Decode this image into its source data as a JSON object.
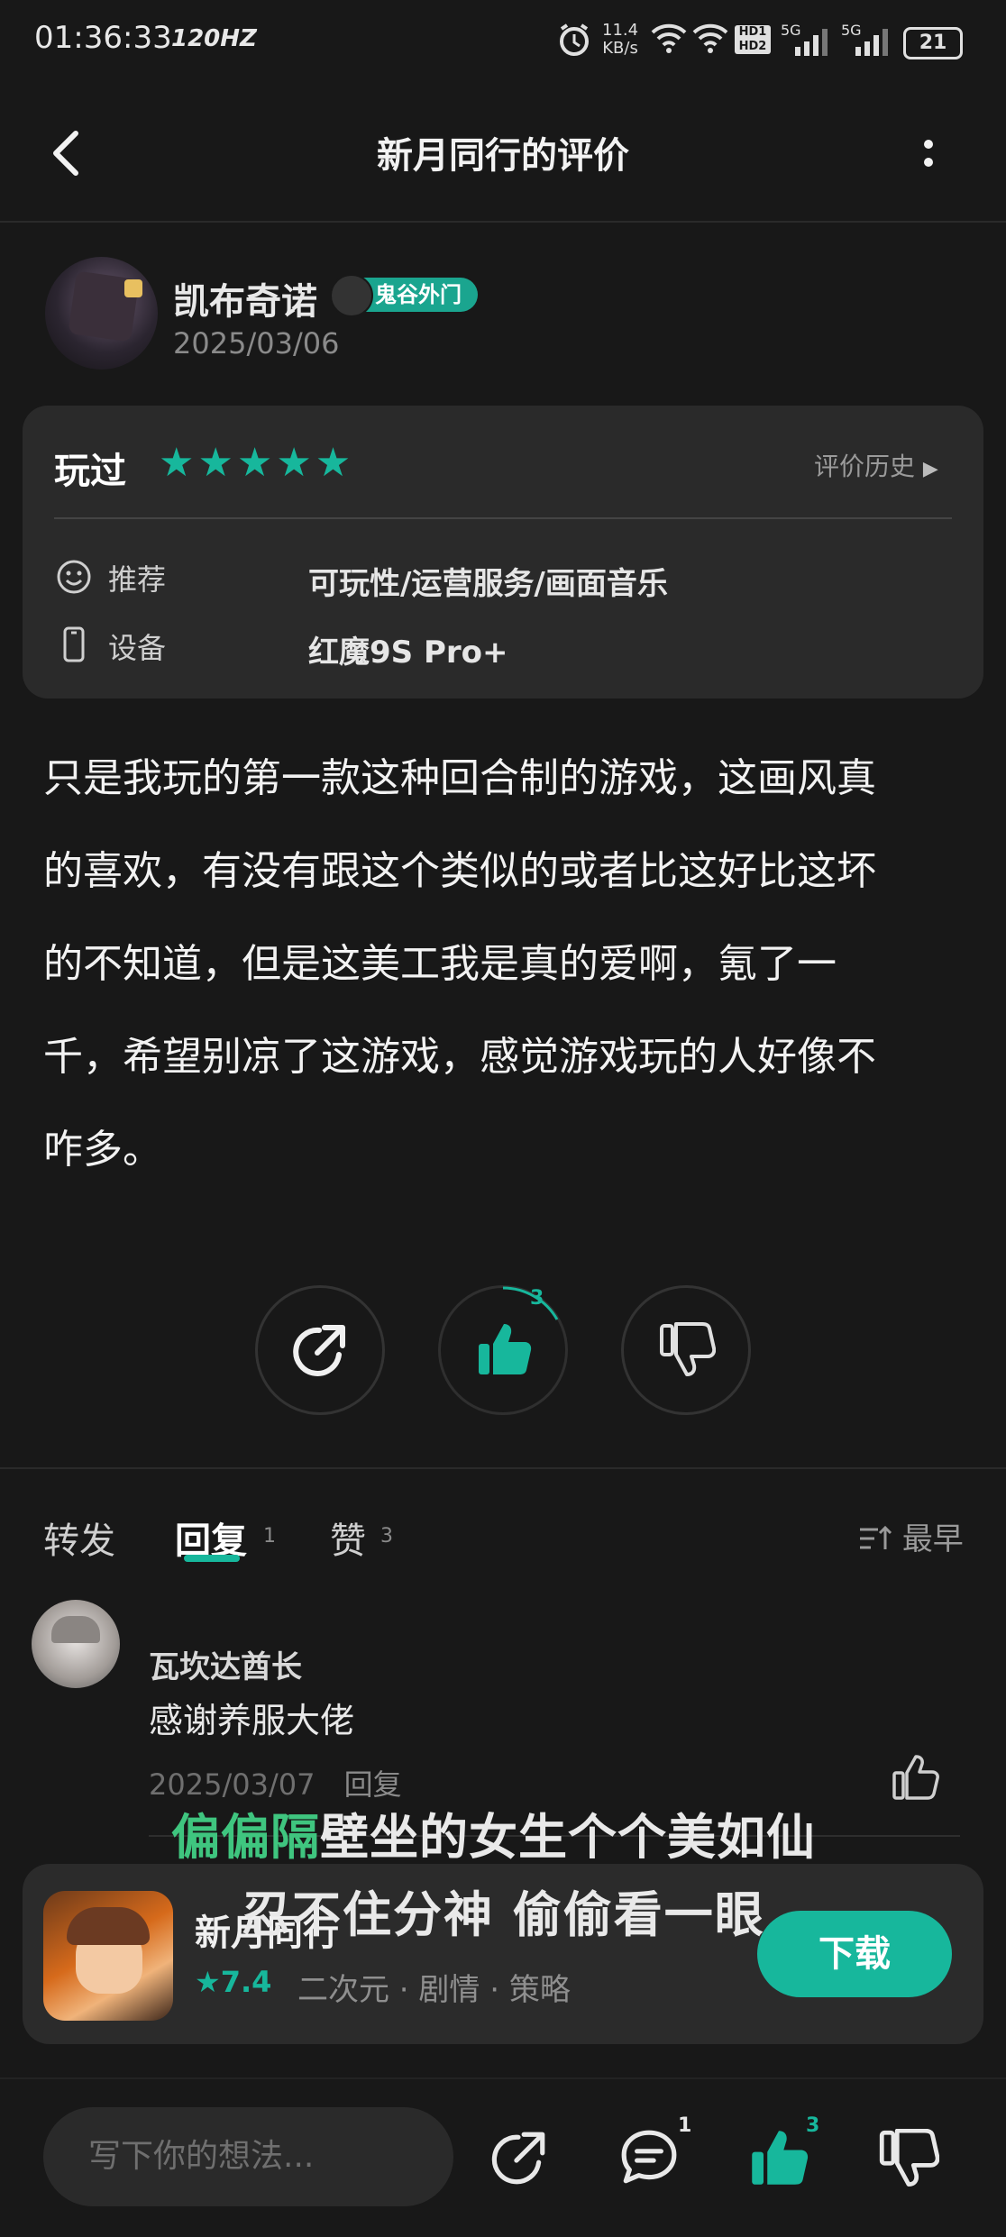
{
  "status_bar": {
    "time": "01:36:33",
    "refresh": "120HZ",
    "net_speed": "11.4",
    "net_unit": "KB/s",
    "hd1": "HD1",
    "hd2": "HD2",
    "sig1": "5G",
    "sig2": "5G",
    "battery": "21"
  },
  "header": {
    "title": "新月同行的评价"
  },
  "reviewer": {
    "name": "凯布奇诺",
    "badge": "鬼谷外门",
    "date": "2025/03/06"
  },
  "info_card": {
    "status": "玩过",
    "stars": 5,
    "stars_text": "★★★★★",
    "history_label": "评价历史",
    "rows": [
      {
        "label": "推荐",
        "value": "可玩性/运营服务/画面音乐"
      },
      {
        "label": "设备",
        "value": "红魔9S Pro+"
      }
    ]
  },
  "review_lines": [
    "只是我玩的第一款这种回合制的游戏，这画风真",
    "的喜欢，有没有跟这个类似的或者比这好比这坏",
    "的不知道，但是这美工我是真的爱啊，氪了一",
    "千，希望别凉了这游戏，感觉游戏玩的人好像不",
    "咋多。"
  ],
  "actions": {
    "like_count": "3"
  },
  "tabs": {
    "forward": "转发",
    "reply": "回复",
    "reply_count": "1",
    "like": "赞",
    "like_count": "3",
    "sort": "最早"
  },
  "comment": {
    "name": "瓦坎达酋长",
    "text": "感谢养服大佬",
    "date": "2025/03/07",
    "reply_label": "回复"
  },
  "lyrics": {
    "line1_highlight": "偏偏隔",
    "line1_rest": "壁坐的女生个个美如仙",
    "line2": "忍不住分神 偷偷看一眼"
  },
  "app_card": {
    "name": "新月同行",
    "rating": "★7.4",
    "tags": "二次元 · 剧情 · 策略",
    "download": "下载"
  },
  "bottom_bar": {
    "placeholder": "写下你的想法...",
    "comment_count": "1",
    "like_count": "3"
  },
  "colors": {
    "accent": "#17b79c",
    "background": "#181818",
    "card": "#2a2a2a"
  }
}
